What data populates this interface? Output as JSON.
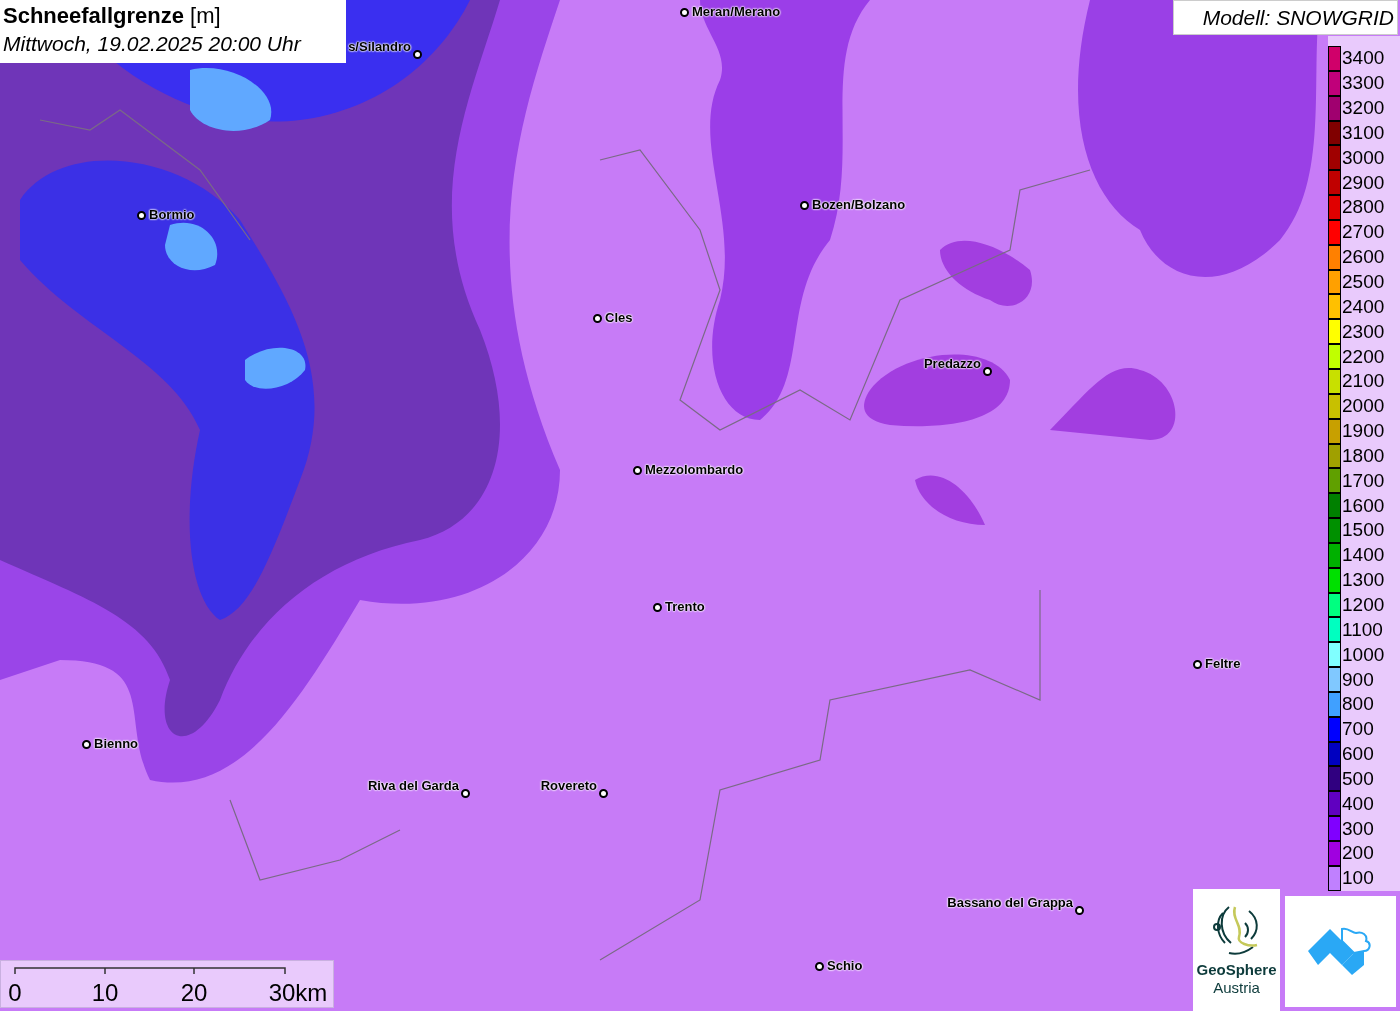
{
  "title": {
    "heading": "**Schneefallgrenze** [m]",
    "subtitle": "Mittwoch, 19.02.2025 20:00 Uhr"
  },
  "model_label": "Modell: SNOWGRID",
  "map": {
    "places": [
      {
        "name": "Meran/Merano"
      },
      {
        "name": "s/Silandro"
      },
      {
        "name": "Bormio"
      },
      {
        "name": "Bozen/Bolzano"
      },
      {
        "name": "Cles"
      },
      {
        "name": "Predazzo"
      },
      {
        "name": "Mezzolombardo"
      },
      {
        "name": "Trento"
      },
      {
        "name": "Feltre"
      },
      {
        "name": "Bienno"
      },
      {
        "name": "Riva del Garda"
      },
      {
        "name": "Rovereto"
      },
      {
        "name": "Bassano del Grappa"
      },
      {
        "name": "Schio"
      }
    ]
  },
  "legend": [
    {
      "label": "3400",
      "color": "#d0006a"
    },
    {
      "label": "3300",
      "color": "#c0007a"
    },
    {
      "label": "3200",
      "color": "#a0006f"
    },
    {
      "label": "3100",
      "color": "#800000"
    },
    {
      "label": "3000",
      "color": "#a00000"
    },
    {
      "label": "2900",
      "color": "#c00000"
    },
    {
      "label": "2800",
      "color": "#e00000"
    },
    {
      "label": "2700",
      "color": "#ff0000"
    },
    {
      "label": "2600",
      "color": "#ff8000"
    },
    {
      "label": "2500",
      "color": "#ffa000"
    },
    {
      "label": "2400",
      "color": "#ffc000"
    },
    {
      "label": "2300",
      "color": "#ffff00"
    },
    {
      "label": "2200",
      "color": "#c0ff00"
    },
    {
      "label": "2100",
      "color": "#c8e000"
    },
    {
      "label": "2000",
      "color": "#c8c000"
    },
    {
      "label": "1900",
      "color": "#c8a000"
    },
    {
      "label": "1800",
      "color": "#a0a000"
    },
    {
      "label": "1700",
      "color": "#60a000"
    },
    {
      "label": "1600",
      "color": "#008000"
    },
    {
      "label": "1500",
      "color": "#009000"
    },
    {
      "label": "1400",
      "color": "#00b000"
    },
    {
      "label": "1300",
      "color": "#00e000"
    },
    {
      "label": "1200",
      "color": "#00ff80"
    },
    {
      "label": "1100",
      "color": "#00ffc0"
    },
    {
      "label": "1000",
      "color": "#80ffff"
    },
    {
      "label": "900",
      "color": "#80c8ff"
    },
    {
      "label": "800",
      "color": "#40a0ff"
    },
    {
      "label": "700",
      "color": "#0000ff"
    },
    {
      "label": "600",
      "color": "#0000c0"
    },
    {
      "label": "500",
      "color": "#300080"
    },
    {
      "label": "400",
      "color": "#6000c0"
    },
    {
      "label": "300",
      "color": "#8000ff"
    },
    {
      "label": "200",
      "color": "#a000e0"
    },
    {
      "label": "100",
      "color": "#c080ff"
    }
  ],
  "scale_bar": {
    "labels": [
      "0",
      "10",
      "20",
      "30km"
    ]
  },
  "logos": [
    {
      "kind": "geosphere",
      "lines": [
        "GeoSphere",
        "Austria"
      ]
    },
    {
      "kind": "cloud"
    }
  ]
}
